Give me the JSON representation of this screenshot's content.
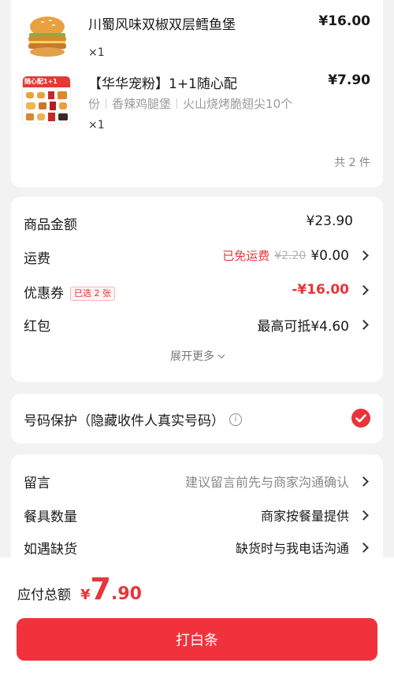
{
  "items": [
    {
      "name": "川蜀风味双椒双层鳕鱼堡",
      "price": "¥16.00",
      "qty": "×1",
      "thumb_icon": "burger-image"
    },
    {
      "name": "【华华宠粉】1+1随心配",
      "price": "¥7.90",
      "qty": "×1",
      "spec": [
        "份",
        "香辣鸡腿堡",
        "火山烧烤脆翅尖10个"
      ],
      "thumb_icon": "combo-image",
      "thumb_text": "随心配1+1"
    }
  ],
  "total_count": "共 2 件",
  "summary": {
    "goods_label": "商品金额",
    "goods_value": "¥23.90",
    "shipping_label": "运费",
    "shipping_free": "已免运费",
    "shipping_original": "¥2.20",
    "shipping_value": "¥0.00",
    "coupon_label": "优惠券",
    "coupon_tag": "已选 2 张",
    "coupon_value": "-¥16.00",
    "redpack_label": "红包",
    "redpack_value": "最高可抵¥4.60",
    "expand_label": "展开更多"
  },
  "privacy": {
    "label": "号码保护（隐藏收件人真实号码）",
    "info_glyph": "i"
  },
  "notes": {
    "message_label": "留言",
    "message_placeholder": "建议留言前先与商家沟通确认",
    "utensils_label": "餐具数量",
    "utensils_value": "商家按餐量提供",
    "outofstock_label": "如遇缺货",
    "outofstock_value": "缺货时与我电话沟通"
  },
  "footer": {
    "total_label": "应付总额",
    "currency": "¥",
    "price_int": "7",
    "price_dec": ".90",
    "pay_button": "打白条"
  },
  "colors": {
    "accent": "#e8343a",
    "button": "#f1323c",
    "background": "#f2f2f2"
  }
}
